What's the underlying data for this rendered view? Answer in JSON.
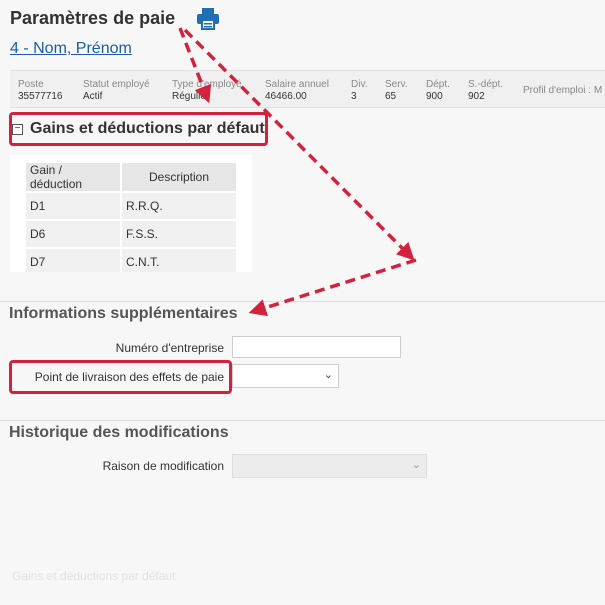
{
  "header": {
    "title": "Paramètres de paie",
    "employee_link": "4 - Nom, Prénom"
  },
  "info_bar": [
    {
      "label": "Poste",
      "value": "35577716"
    },
    {
      "label": "Statut employé",
      "value": "Actif"
    },
    {
      "label": "Type d'employé",
      "value": "Régulier"
    },
    {
      "label": "Salaire annuel",
      "value": "46466.00"
    },
    {
      "label": "Div.",
      "value": "3"
    },
    {
      "label": "Serv.",
      "value": "65"
    },
    {
      "label": "Dépt.",
      "value": "900"
    },
    {
      "label": "S.-dépt.",
      "value": "902"
    },
    {
      "label": "Profil d'emploi : M",
      "value": ""
    }
  ],
  "gains": {
    "title": "Gains et déductions par défaut",
    "columns": [
      "Gain / déduction",
      "Description"
    ],
    "rows": [
      [
        "D1",
        "R.R.Q."
      ],
      [
        "D6",
        "F.S.S."
      ],
      [
        "D7",
        "C.N.T."
      ]
    ]
  },
  "supplementaires": {
    "title": "Informations supplémentaires",
    "numero_label": "Numéro d'entreprise",
    "numero_value": "",
    "livraison_label": "Point de livraison des effets de paie",
    "livraison_value": ""
  },
  "historique": {
    "title": "Historique des modifications",
    "raison_label": "Raison de modification",
    "raison_value": ""
  },
  "footer_ghost": "Gains et déductions par défaut",
  "colors": {
    "highlight": "#d2223e",
    "link": "#1a5ca8"
  }
}
